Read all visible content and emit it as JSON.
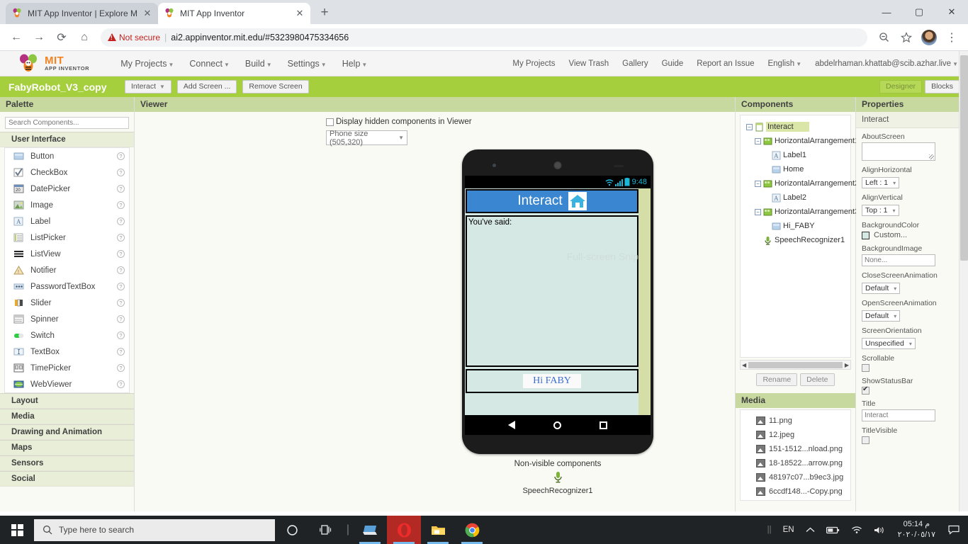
{
  "browser": {
    "tabs": [
      {
        "title": "MIT App Inventor | Explore MIT A",
        "favicon": "appinventor-icon",
        "active": false
      },
      {
        "title": "MIT App Inventor",
        "favicon": "appinventor-icon",
        "active": true
      }
    ],
    "new_tab_label": "+",
    "window_controls": {
      "minimize": "—",
      "maximize": "▢",
      "close": "✕"
    },
    "nav": {
      "back": "←",
      "forward": "→",
      "reload": "⟳",
      "home": "⌂"
    },
    "security_label": "Not secure",
    "url": "ai2.appinventor.mit.edu/#5323980475334656",
    "toolbar_icons": {
      "zoom": "search-minus-icon",
      "bookmark": "star-icon",
      "profile": "avatar",
      "menu": "⋮"
    }
  },
  "appinventor": {
    "logo": {
      "line1": "MIT",
      "line2": "APP INVENTOR"
    },
    "menu": [
      {
        "label": "My Projects",
        "caret": true
      },
      {
        "label": "Connect",
        "caret": true
      },
      {
        "label": "Build",
        "caret": true
      },
      {
        "label": "Settings",
        "caret": true
      },
      {
        "label": "Help",
        "caret": true
      }
    ],
    "top_right": [
      {
        "label": "My Projects",
        "caret": false
      },
      {
        "label": "View Trash",
        "caret": false
      },
      {
        "label": "Gallery",
        "caret": false
      },
      {
        "label": "Guide",
        "caret": false
      },
      {
        "label": "Report an Issue",
        "caret": false
      },
      {
        "label": "English",
        "caret": true
      },
      {
        "label": "abdelrhaman.khattab@scib.azhar.live",
        "caret": true
      }
    ],
    "project_bar": {
      "project_name": "FabyRobot_V3_copy",
      "screen_selector": "Interact",
      "add_screen": "Add Screen ...",
      "remove_screen": "Remove Screen",
      "designer_tab": "Designer",
      "blocks_tab": "Blocks"
    },
    "palette": {
      "title": "Palette",
      "search_placeholder": "Search Components...",
      "search_value": "",
      "open_category": "User Interface",
      "components": [
        {
          "name": "Button",
          "icon": "button-icon"
        },
        {
          "name": "CheckBox",
          "icon": "checkbox-icon"
        },
        {
          "name": "DatePicker",
          "icon": "datepicker-icon"
        },
        {
          "name": "Image",
          "icon": "image-icon"
        },
        {
          "name": "Label",
          "icon": "label-icon"
        },
        {
          "name": "ListPicker",
          "icon": "listpicker-icon"
        },
        {
          "name": "ListView",
          "icon": "listview-icon"
        },
        {
          "name": "Notifier",
          "icon": "notifier-icon"
        },
        {
          "name": "PasswordTextBox",
          "icon": "passwordtextbox-icon"
        },
        {
          "name": "Slider",
          "icon": "slider-icon"
        },
        {
          "name": "Spinner",
          "icon": "spinner-icon"
        },
        {
          "name": "Switch",
          "icon": "switch-icon"
        },
        {
          "name": "TextBox",
          "icon": "textbox-icon"
        },
        {
          "name": "TimePicker",
          "icon": "timepicker-icon"
        },
        {
          "name": "WebViewer",
          "icon": "webviewer-icon"
        }
      ],
      "help_glyph": "?",
      "categories": [
        "Layout",
        "Media",
        "Drawing and Animation",
        "Maps",
        "Sensors",
        "Social"
      ]
    },
    "viewer": {
      "title": "Viewer",
      "hidden_components_label": "Display hidden components in Viewer",
      "hidden_components_checked": false,
      "size_option": "Phone size (505,320)",
      "phone": {
        "status_time": "9:48",
        "title_bar_text": "Interact",
        "title_bar_icon": "home-icon",
        "label2_text": "You've said:",
        "button_hifaby": "Hi FABY",
        "ghost_overlay": "Full-screen Snip",
        "nav_back": "back-icon",
        "nav_home": "home-circle-icon",
        "nav_recents": "recents-square-icon"
      },
      "nonvisible_title": "Non-visible components",
      "nonvisible": [
        {
          "name": "SpeechRecognizer1",
          "icon": "speechrecognizer-icon"
        }
      ]
    },
    "components_panel": {
      "title": "Components",
      "tree": [
        {
          "label": "Interact",
          "depth": 0,
          "expander": "−",
          "icon": "screen-icon",
          "selected": true
        },
        {
          "label": "HorizontalArrangement1",
          "depth": 1,
          "expander": "−",
          "icon": "arrangement-icon",
          "selected": false
        },
        {
          "label": "Label1",
          "depth": 2,
          "expander": "",
          "icon": "label-icon",
          "selected": false
        },
        {
          "label": "Home",
          "depth": 2,
          "expander": "",
          "icon": "button-icon",
          "selected": false
        },
        {
          "label": "HorizontalArrangement2",
          "depth": 1,
          "expander": "−",
          "icon": "arrangement-icon",
          "selected": false
        },
        {
          "label": "Label2",
          "depth": 2,
          "expander": "",
          "icon": "label-icon",
          "selected": false
        },
        {
          "label": "HorizontalArrangement3",
          "depth": 1,
          "expander": "−",
          "icon": "arrangement-icon",
          "selected": false
        },
        {
          "label": "Hi_FABY",
          "depth": 2,
          "expander": "",
          "icon": "button-icon",
          "selected": false
        },
        {
          "label": "SpeechRecognizer1",
          "depth": 1,
          "expander": "",
          "icon": "speechrecognizer-icon",
          "selected": false
        }
      ],
      "rename_label": "Rename",
      "delete_label": "Delete"
    },
    "media_panel": {
      "title": "Media",
      "files": [
        "11.png",
        "12.jpeg",
        "151-1512...nload.png",
        "18-18522...arrow.png",
        "48197c07...b9ec3.jpg",
        "6ccdf148...-Copy.png"
      ]
    },
    "properties": {
      "title": "Properties",
      "selected_component": "Interact",
      "fields": [
        {
          "label": "AboutScreen",
          "type": "textarea",
          "value": ""
        },
        {
          "label": "AlignHorizontal",
          "type": "dropdown",
          "value": "Left : 1"
        },
        {
          "label": "AlignVertical",
          "type": "dropdown",
          "value": "Top : 1"
        },
        {
          "label": "BackgroundColor",
          "type": "color",
          "value": "Custom...",
          "swatch": "#d5e8e4"
        },
        {
          "label": "BackgroundImage",
          "type": "input",
          "value": "None..."
        },
        {
          "label": "CloseScreenAnimation",
          "type": "dropdown",
          "value": "Default"
        },
        {
          "label": "OpenScreenAnimation",
          "type": "dropdown",
          "value": "Default"
        },
        {
          "label": "ScreenOrientation",
          "type": "dropdown",
          "value": "Unspecified"
        },
        {
          "label": "Scrollable",
          "type": "checkbox",
          "checked": false
        },
        {
          "label": "ShowStatusBar",
          "type": "checkbox",
          "checked": true
        },
        {
          "label": "Title",
          "type": "input",
          "value": "Interact"
        },
        {
          "label": "TitleVisible",
          "type": "checkbox",
          "checked": false
        }
      ]
    },
    "colors": {
      "accent_green": "#a5cf3d",
      "panel_head": "#c8d9a0",
      "titlebar_blue": "#3b86d1",
      "screen_bg": "#d5e8e4",
      "orange": "#f58220"
    }
  },
  "taskbar": {
    "start": "windows-logo",
    "search_placeholder": "Type here to search",
    "icons": [
      {
        "name": "cortana-icon",
        "glyph": "○"
      },
      {
        "name": "task-view-icon",
        "glyph": "❏"
      },
      {
        "name": "separator",
        "glyph": "|"
      },
      {
        "name": "remote-desktop-icon",
        "glyph": "🖥"
      },
      {
        "name": "opera-icon",
        "glyph": "O"
      },
      {
        "name": "file-explorer-icon",
        "glyph": "📁"
      },
      {
        "name": "chrome-icon",
        "glyph": "◉"
      }
    ],
    "tray": {
      "separator": "||",
      "language": "EN",
      "chevron": "︿",
      "battery": "battery-icon",
      "wifi": "wifi-icon",
      "volume": "volume-icon",
      "time": "05:14 م",
      "date": "٢٠٢٠/٠٥/١٧",
      "notifications": "notification-icon"
    }
  }
}
